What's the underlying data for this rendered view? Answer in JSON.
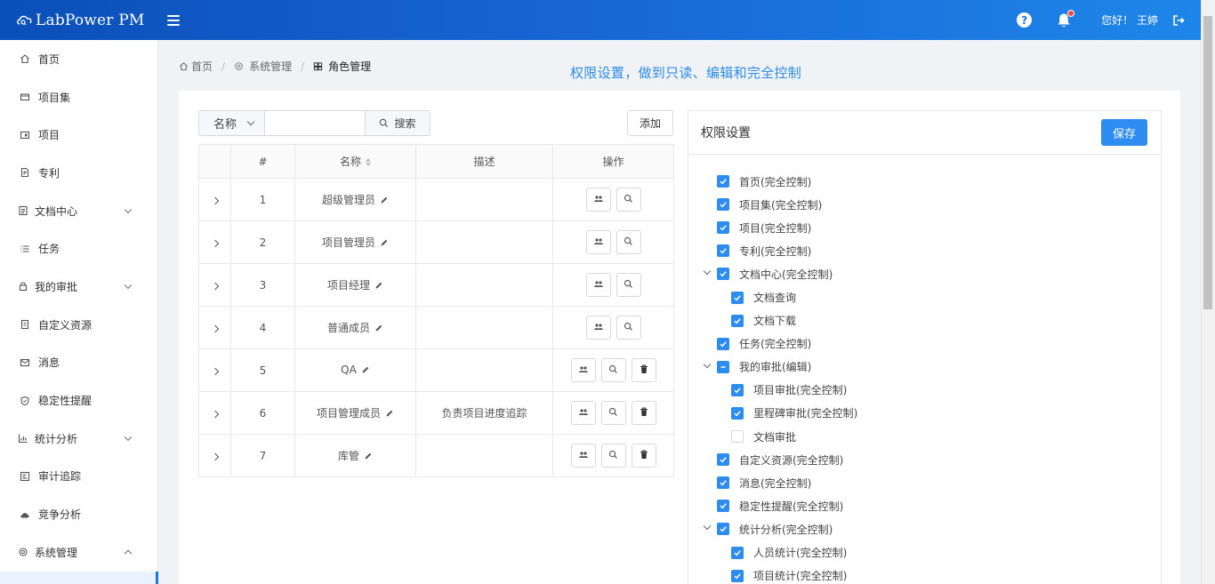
{
  "header": {
    "logo_text": "LabPower PM",
    "greeting": "您好！ 王婷",
    "notification_dot_color": "#f5483b"
  },
  "sidebar": {
    "items": [
      {
        "label": "首页",
        "icon": "home-icon"
      },
      {
        "label": "项目集",
        "icon": "folder-icon"
      },
      {
        "label": "项目",
        "icon": "project-icon"
      },
      {
        "label": "专利",
        "icon": "patent-icon"
      },
      {
        "label": "文档中心",
        "icon": "document-icon",
        "expandable": true
      },
      {
        "label": "任务",
        "icon": "list-icon"
      },
      {
        "label": "我的审批",
        "icon": "lock-icon",
        "expandable": true
      },
      {
        "label": "自定义资源",
        "icon": "resource-icon"
      },
      {
        "label": "消息",
        "icon": "mail-icon"
      },
      {
        "label": "稳定性提醒",
        "icon": "shield-icon"
      },
      {
        "label": "统计分析",
        "icon": "chart-icon",
        "expandable": true
      },
      {
        "label": "审计追踪",
        "icon": "audit-icon"
      },
      {
        "label": "竞争分析",
        "icon": "cloud-icon"
      },
      {
        "label": "系统管理",
        "icon": "gear-icon",
        "expandable": true,
        "expanded": true
      }
    ]
  },
  "breadcrumb": {
    "home": "首页",
    "system": "系统管理",
    "current": "角色管理"
  },
  "page_note": "权限设置，做到只读、编辑和完全控制",
  "search": {
    "field_select": "名称",
    "input_value": "",
    "input_placeholder": "",
    "button_label": "搜索"
  },
  "add_button": "添加",
  "table": {
    "columns": [
      "#",
      "名称",
      "描述",
      "操作"
    ],
    "rows": [
      {
        "num": "1",
        "name": "超级管理员",
        "desc": "",
        "deletable": false
      },
      {
        "num": "2",
        "name": "项目管理员",
        "desc": "",
        "deletable": false
      },
      {
        "num": "3",
        "name": "项目经理",
        "desc": "",
        "deletable": false
      },
      {
        "num": "4",
        "name": "普通成员",
        "desc": "",
        "deletable": false
      },
      {
        "num": "5",
        "name": "QA",
        "desc": "",
        "deletable": true
      },
      {
        "num": "6",
        "name": "项目管理成员",
        "desc": "负责项目进度追踪",
        "deletable": true
      },
      {
        "num": "7",
        "name": "库管",
        "desc": "",
        "deletable": true
      }
    ]
  },
  "permissions": {
    "title": "权限设置",
    "save_label": "保存",
    "accent": "#2d8cf0",
    "tree": [
      {
        "label": "首页(完全控制)",
        "level": 0,
        "state": "checked",
        "expandable": false
      },
      {
        "label": "项目集(完全控制)",
        "level": 0,
        "state": "checked",
        "expandable": false
      },
      {
        "label": "项目(完全控制)",
        "level": 0,
        "state": "checked",
        "expandable": false
      },
      {
        "label": "专利(完全控制)",
        "level": 0,
        "state": "checked",
        "expandable": false
      },
      {
        "label": "文档中心(完全控制)",
        "level": 0,
        "state": "checked",
        "expandable": true
      },
      {
        "label": "文档查询",
        "level": 1,
        "state": "checked",
        "expandable": false
      },
      {
        "label": "文档下载",
        "level": 1,
        "state": "checked",
        "expandable": false
      },
      {
        "label": "任务(完全控制)",
        "level": 0,
        "state": "checked",
        "expandable": false
      },
      {
        "label": "我的审批(编辑)",
        "level": 0,
        "state": "indeterminate",
        "expandable": true
      },
      {
        "label": "项目审批(完全控制)",
        "level": 1,
        "state": "checked",
        "expandable": false
      },
      {
        "label": "里程碑审批(完全控制)",
        "level": 1,
        "state": "checked",
        "expandable": false
      },
      {
        "label": "文档审批",
        "level": 1,
        "state": "unchecked",
        "expandable": false
      },
      {
        "label": "自定义资源(完全控制)",
        "level": 0,
        "state": "checked",
        "expandable": false
      },
      {
        "label": "消息(完全控制)",
        "level": 0,
        "state": "checked",
        "expandable": false
      },
      {
        "label": "稳定性提醒(完全控制)",
        "level": 0,
        "state": "checked",
        "expandable": false
      },
      {
        "label": "统计分析(完全控制)",
        "level": 0,
        "state": "checked",
        "expandable": true
      },
      {
        "label": "人员统计(完全控制)",
        "level": 1,
        "state": "checked",
        "expandable": false
      },
      {
        "label": "项目统计(完全控制)",
        "level": 1,
        "state": "checked",
        "expandable": false
      }
    ]
  }
}
